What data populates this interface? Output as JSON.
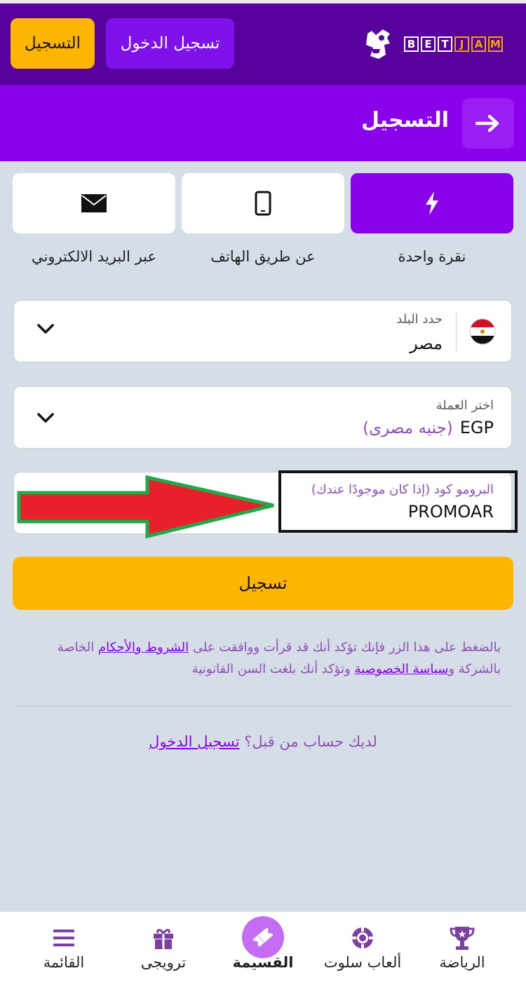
{
  "header": {
    "register_label": "التسجيل",
    "login_label": "تسجيل الدخول",
    "logo_letters": [
      "B",
      "E",
      "T",
      "J",
      "A",
      "M"
    ]
  },
  "subheader": {
    "title": "التسجيل"
  },
  "tabs": [
    {
      "label": "نقرة واحدة",
      "icon": "lightning-icon",
      "active": true
    },
    {
      "label": "عن طريق الهاتف",
      "icon": "phone-icon",
      "active": false
    },
    {
      "label": "عبر البريد الالكتروني",
      "icon": "envelope-icon",
      "active": false
    }
  ],
  "country": {
    "label": "حدد البلد",
    "value": "مصر",
    "flag": "egypt-flag-icon"
  },
  "currency": {
    "label": "اختر العملة",
    "code": "EGP",
    "name": "(جنيه مصرى)"
  },
  "promo": {
    "label": "البرومو كود (إذا كان موجودًا عندك)",
    "value": "PROMOAR"
  },
  "submit_label": "تسجيل",
  "terms": {
    "text1": "بالضغط على هذا الزر فإنك تؤكد أنك قد قرأت ووافقت على",
    "link1": "الشروط والأحكام",
    "text2": "الخاصة بالشركة و",
    "link2": "سياسة الخصوصية",
    "text3": "وتؤكد أنك بلغت السن القانونية"
  },
  "have_account": {
    "text": "لديك حساب من قبل؟",
    "link": "تسجيل الدخول"
  },
  "bottom_nav": [
    {
      "label": "الرياضة",
      "icon": "trophy-icon"
    },
    {
      "label": "ألعاب سلوت",
      "icon": "casino-chip-icon"
    },
    {
      "label": "القسيمة",
      "icon": "ticket-icon"
    },
    {
      "label": "ترويجى",
      "icon": "gift-icon"
    },
    {
      "label": "القائمة",
      "icon": "menu-icon"
    }
  ],
  "colors": {
    "brand_purple": "#8a00ea",
    "dark_purple": "#58009b",
    "accent_yellow": "#fcb500",
    "annotation_arrow": "#e8202a",
    "annotation_arrow_border": "#22a84a"
  }
}
